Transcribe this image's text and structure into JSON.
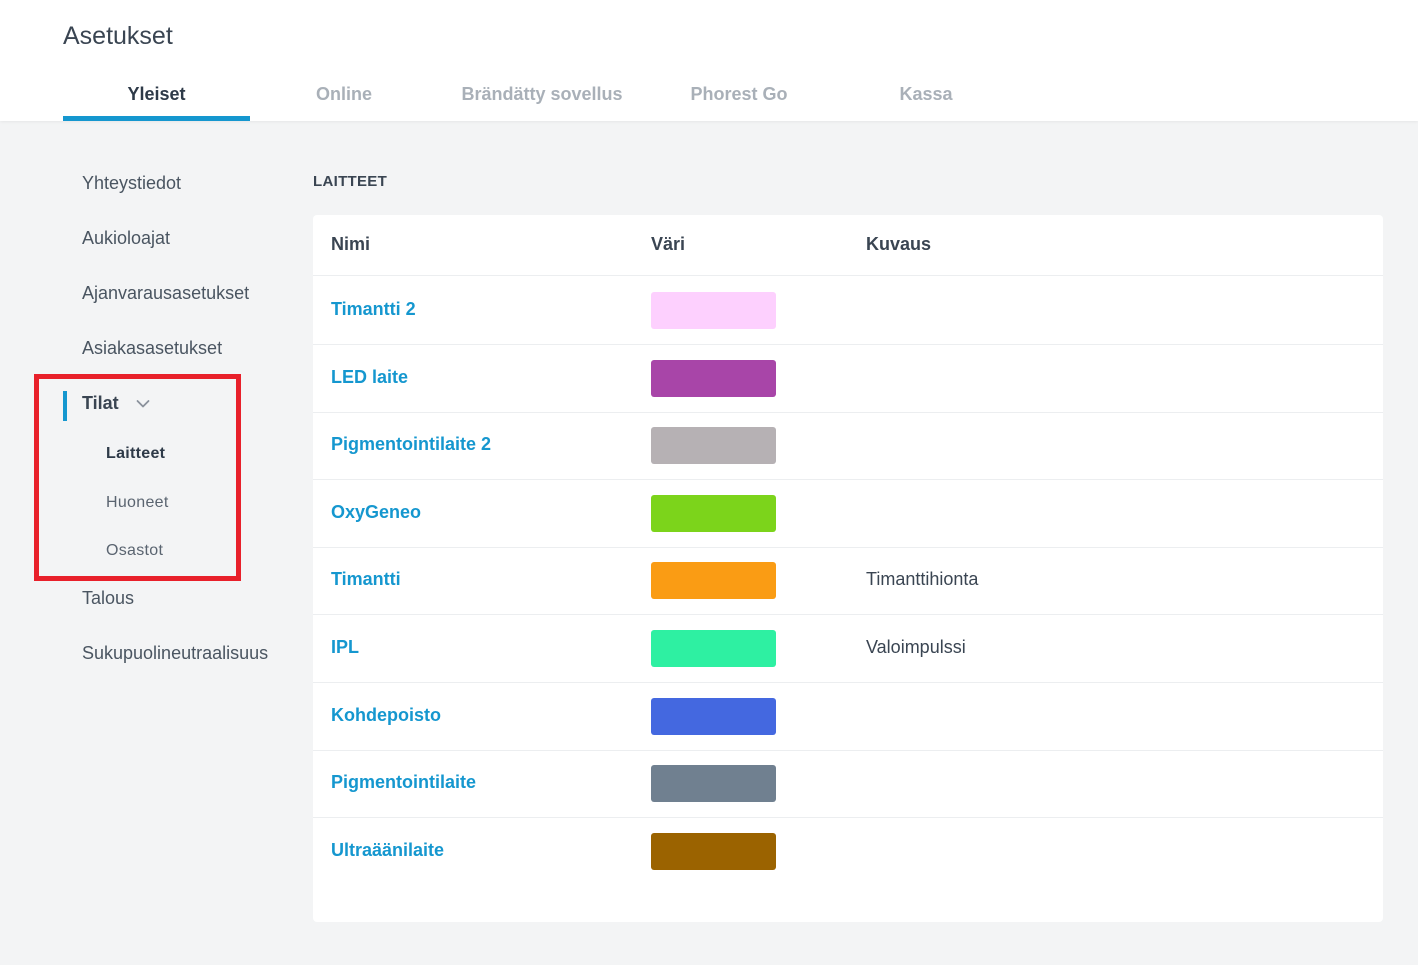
{
  "header": {
    "title": "Asetukset",
    "tabs": [
      {
        "label": "Yleiset",
        "active": true
      },
      {
        "label": "Online",
        "active": false
      },
      {
        "label": "Brändätty sovellus",
        "active": false
      },
      {
        "label": "Phorest Go",
        "active": false
      },
      {
        "label": "Kassa",
        "active": false
      }
    ]
  },
  "sidebar": {
    "items": [
      {
        "label": "Yhteystiedot"
      },
      {
        "label": "Aukioloajat"
      },
      {
        "label": "Ajanvarausasetukset"
      },
      {
        "label": "Asiakasasetukset"
      },
      {
        "label": "Tilat",
        "expanded": true
      },
      {
        "label": "Talous"
      },
      {
        "label": "Sukupuolineutraalisuus"
      }
    ],
    "sub_items": [
      {
        "label": "Laitteet",
        "active": true
      },
      {
        "label": "Huoneet",
        "active": false
      },
      {
        "label": "Osastot",
        "active": false
      }
    ]
  },
  "main": {
    "section_title": "LAITTEET",
    "columns": [
      "Nimi",
      "Väri",
      "Kuvaus"
    ],
    "rows": [
      {
        "name": "Timantti 2",
        "color": "#fdd0fe",
        "description": ""
      },
      {
        "name": "LED laite",
        "color": "#a845a8",
        "description": ""
      },
      {
        "name": "Pigmentointilaite 2",
        "color": "#b6b1b4",
        "description": ""
      },
      {
        "name": "OxyGeneo",
        "color": "#7cd41b",
        "description": ""
      },
      {
        "name": "Timantti",
        "color": "#fa9c14",
        "description": "Timanttihionta"
      },
      {
        "name": "IPL",
        "color": "#2ef0a2",
        "description": "Valoimpulssi"
      },
      {
        "name": "Kohdepoisto",
        "color": "#4468e0",
        "description": ""
      },
      {
        "name": "Pigmentointilaite",
        "color": "#708090",
        "description": ""
      },
      {
        "name": "Ultraäänilaite",
        "color": "#9b6300",
        "description": ""
      }
    ]
  },
  "colors": {
    "accent": "#1597cf",
    "highlight": "#e8202a"
  }
}
